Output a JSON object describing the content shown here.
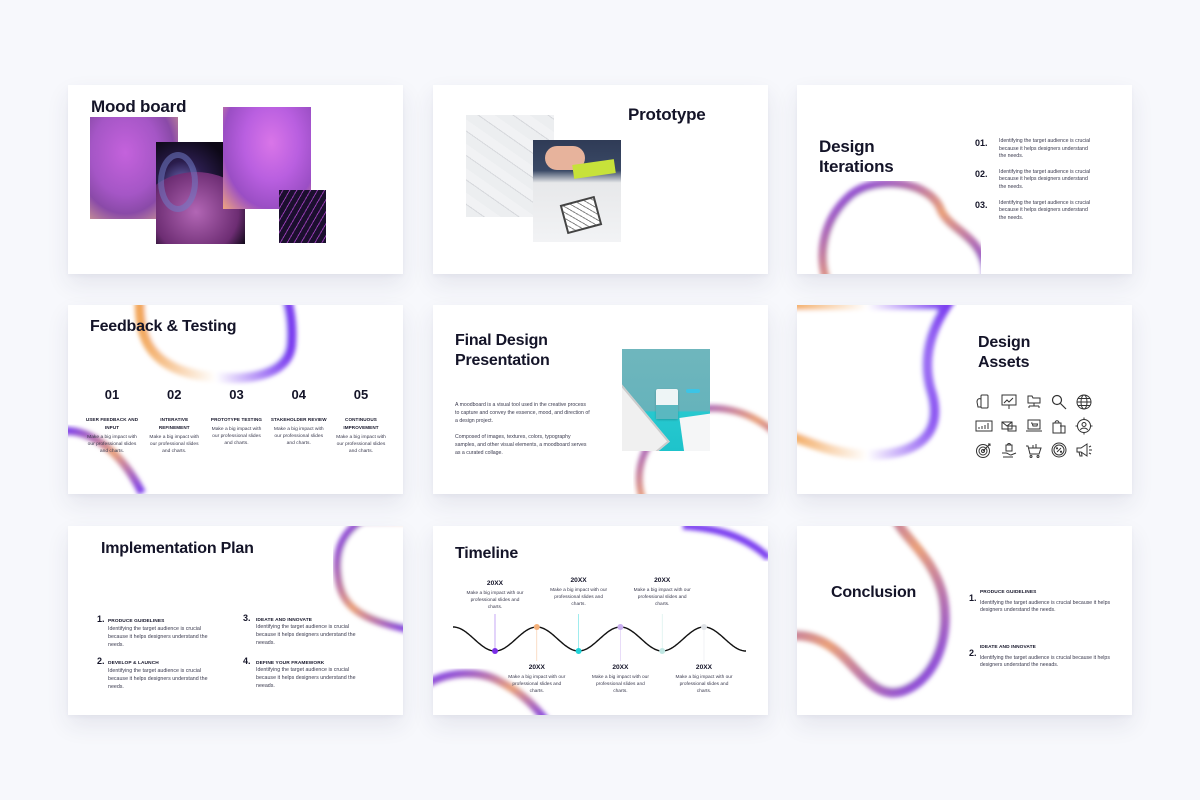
{
  "page_background": "#f7f8fc",
  "accent_colors": {
    "purple": "#7a3cf0",
    "orange": "#f2a65a",
    "violet": "#b95fe0",
    "text": "#141428"
  },
  "slides": {
    "mood_board": {
      "title": "Mood board"
    },
    "prototype": {
      "title": "Prototype"
    },
    "design_iterations": {
      "title_line1": "Design",
      "title_line2": "Iterations",
      "items": [
        {
          "num": "01.",
          "text": "Identifying the target audience is crucial because it helps designers understand the needs."
        },
        {
          "num": "02.",
          "text": "Identifying the target audience is crucial because it helps designers understand the needs."
        },
        {
          "num": "03.",
          "text": "Identifying the target audience is crucial because it helps designers understand the needs."
        }
      ]
    },
    "feedback_testing": {
      "title": "Feedback & Testing",
      "steps": [
        {
          "num": "01",
          "label": "USER FEEDBACK AND INPUT",
          "desc": "Make a big impact with our professional slides and charts."
        },
        {
          "num": "02",
          "label": "INTERATIVE REFINEMENT",
          "desc": "Make a big impact with our professional slides and charts."
        },
        {
          "num": "03",
          "label": "PROTOTYPE TESTING",
          "desc": "Make a big impact with our professional slides and charts."
        },
        {
          "num": "04",
          "label": "STAKEHOLDER REVIEW",
          "desc": "Make a big impact with our professional slides and charts."
        },
        {
          "num": "05",
          "label": "CONTINUOUS IMPROVEMENT",
          "desc": "Make a big impact with our professional slides and charts."
        }
      ]
    },
    "final_design": {
      "title_line1": "Final Design",
      "title_line2": "Presentation",
      "para1": "A moodboard is a visual tool used in the creative process to capture and convey the essence, mood, and direction of a design project.",
      "para2": "Composed of images, textures, colors, typography samples, and other visual elements, a moodboard serves as a curated collage."
    },
    "design_assets": {
      "title_line1": "Design",
      "title_line2": "Assets",
      "icons": [
        "mobile-hand-icon",
        "presentation-chart-icon",
        "folder-network-icon",
        "search-magnifier-icon",
        "globe-icon",
        "analytics-screen-icon",
        "email-envelopes-icon",
        "laptop-cart-icon",
        "shopping-bags-icon",
        "target-user-icon",
        "dartboard-target-icon",
        "hand-bag-icon",
        "shopping-basket-icon",
        "percent-badge-icon",
        "megaphone-icon"
      ]
    },
    "implementation_plan": {
      "title": "Implementation Plan",
      "items": [
        {
          "num": "1.",
          "heading": "PRODUCE GUIDELINES",
          "text": "Identifying the target audience is crucial because it helps designers understand the needs."
        },
        {
          "num": "2.",
          "heading": "DEVELOP & LAUNCH",
          "text": "Identifying the target audience is crucial because it helps designers understand the needs."
        },
        {
          "num": "3.",
          "heading": "IDEATE AND INNOVATE",
          "text": "Identifying the target audience is crucial because it helps designers understand the neeads."
        },
        {
          "num": "4.",
          "heading": "DEFINE YOUR FRAMEWORK",
          "text": "Identifying the target audience is crucial because it helps designers understand the neeads."
        }
      ]
    },
    "timeline": {
      "title": "Timeline",
      "events": [
        {
          "year": "20XX",
          "desc": "Make a big impact with our professional slides and charts.",
          "position": "top",
          "dot_color": "#7a2fe6"
        },
        {
          "year": "20XX",
          "desc": "Make a big impact with our professional slides and charts.",
          "position": "bottom",
          "dot_color": "#f4b07a"
        },
        {
          "year": "20XX",
          "desc": "Make a big impact with our professional slides and charts.",
          "position": "top",
          "dot_color": "#1fd3d8"
        },
        {
          "year": "20XX",
          "desc": "Make a big impact with our professional slides and charts.",
          "position": "bottom",
          "dot_color": "#c9aef0"
        },
        {
          "year": "20XX",
          "desc": "Make a big impact with our professional slides and charts.",
          "position": "top",
          "dot_color": "#bfe6e2"
        },
        {
          "year": "20XX",
          "desc": "Make a big impact with our professional slides and charts.",
          "position": "bottom",
          "dot_color": "#dfe2e6"
        }
      ]
    },
    "conclusion": {
      "title": "Conclusion",
      "items": [
        {
          "num": "1.",
          "heading": "PRODUCE GUIDELINES",
          "text": "Identifying the target audience is crucial because it helps designers understand the needs."
        },
        {
          "num": "2.",
          "heading": "IDEATE AND INNOVATE",
          "text": "Identifying the target audience is crucial because it helps designers understand the neeads."
        }
      ]
    }
  }
}
